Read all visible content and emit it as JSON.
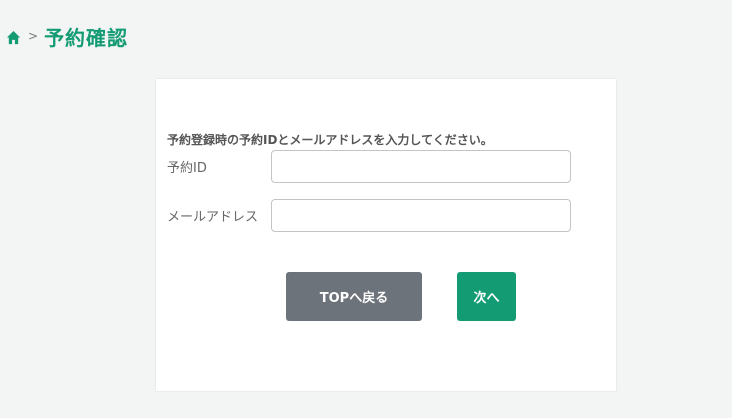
{
  "breadcrumb": {
    "home_icon": "home-icon",
    "separator": ">",
    "title": "予約確認"
  },
  "form": {
    "instruction": "予約登録時の予約IDとメールアドレスを入力してください。",
    "reservation_id": {
      "label": "予約ID",
      "value": "",
      "placeholder": ""
    },
    "email": {
      "label": "メールアドレス",
      "value": "",
      "placeholder": ""
    }
  },
  "buttons": {
    "back_label": "TOPへ戻る",
    "next_label": "次へ"
  },
  "colors": {
    "accent": "#139b74",
    "secondary_button": "#6c737b",
    "background": "#f3f5f4"
  }
}
